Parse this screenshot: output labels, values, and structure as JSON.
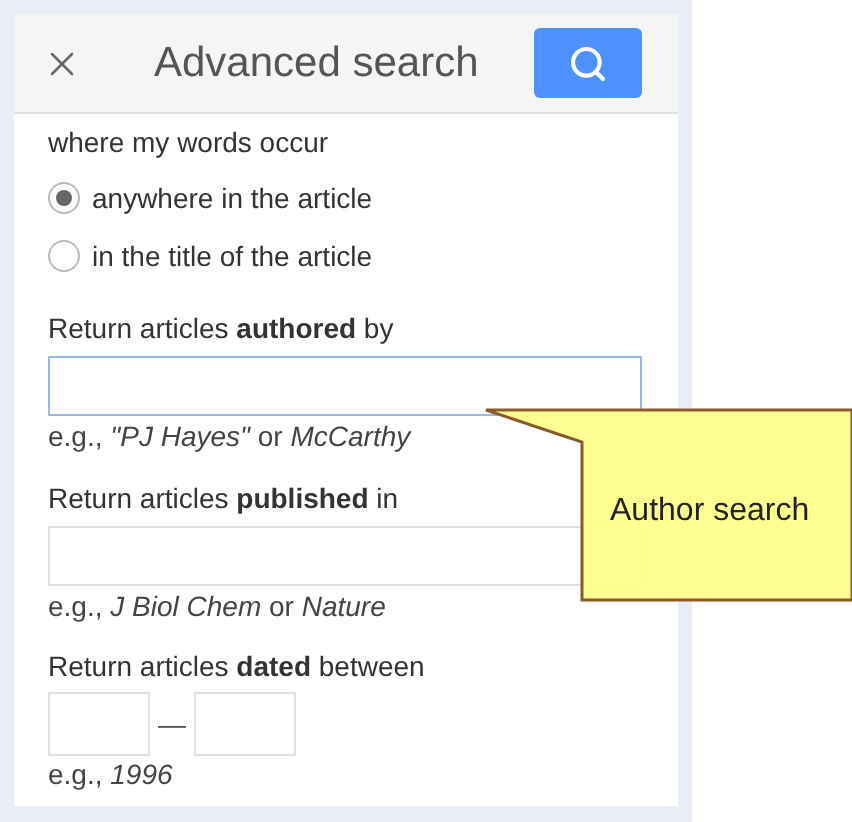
{
  "header": {
    "title": "Advanced search"
  },
  "occurrence": {
    "label": "where my words occur",
    "options": [
      {
        "label": "anywhere in the article",
        "selected": true
      },
      {
        "label": "in the title of the article",
        "selected": false
      }
    ]
  },
  "fields": [
    {
      "label": "Return articles **authored** by",
      "hint": "e.g., *\"PJ Hayes\"* or *McCarthy*",
      "focused": true
    },
    {
      "label": "Return articles **published** in",
      "hint": "e.g., *J Biol Chem* or *Nature*",
      "focused": false
    }
  ],
  "dates": {
    "label": "Return articles **dated** between",
    "separator": "—",
    "hint": "e.g., *1996*"
  },
  "callout": {
    "text": "Author search"
  }
}
